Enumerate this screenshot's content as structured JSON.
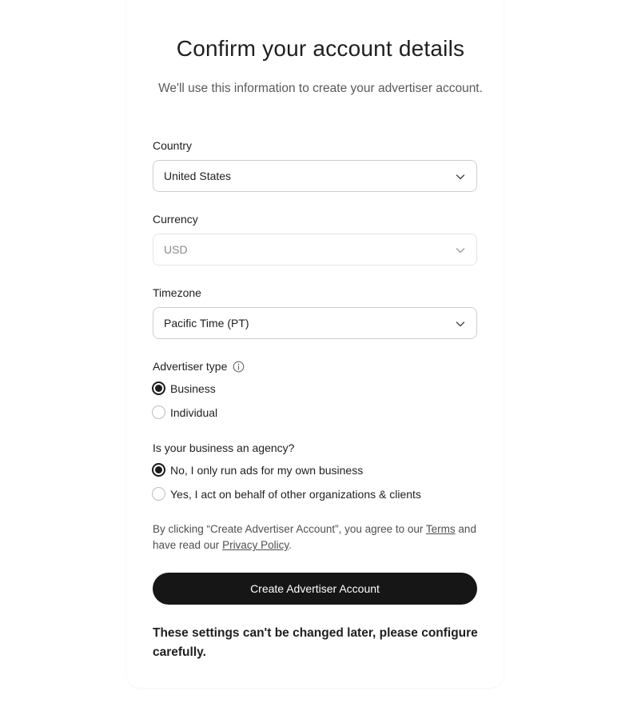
{
  "header": {
    "title": "Confirm your account details",
    "subtitle": "We'll use this information to create your advertiser account."
  },
  "country": {
    "label": "Country",
    "value": "United States"
  },
  "currency": {
    "label": "Currency",
    "value": "USD",
    "disabled": true
  },
  "timezone": {
    "label": "Timezone",
    "value": "Pacific Time (PT)"
  },
  "advertiser_type": {
    "label": "Advertiser type",
    "info_icon": "info-circle-icon",
    "options": [
      {
        "label": "Business",
        "selected": true
      },
      {
        "label": "Individual",
        "selected": false
      }
    ]
  },
  "agency": {
    "label": "Is your business an agency?",
    "options": [
      {
        "label": "No, I only run ads for my own business",
        "selected": true
      },
      {
        "label": "Yes, I act on behalf of other organizations & clients",
        "selected": false
      }
    ]
  },
  "legal": {
    "prefix": "By clicking “Create Advertiser Account”, you agree to our ",
    "terms_link": "Terms",
    "middle": " and have read our ",
    "privacy_link": "Privacy Policy",
    "suffix": "."
  },
  "cta": {
    "label": "Create Advertiser Account"
  },
  "warning": {
    "text": "These settings can't be changed later, please configure carefully."
  },
  "colors": {
    "primary_button": "#161616",
    "border": "#cfcfcf",
    "muted_text": "#5a5a5a"
  }
}
